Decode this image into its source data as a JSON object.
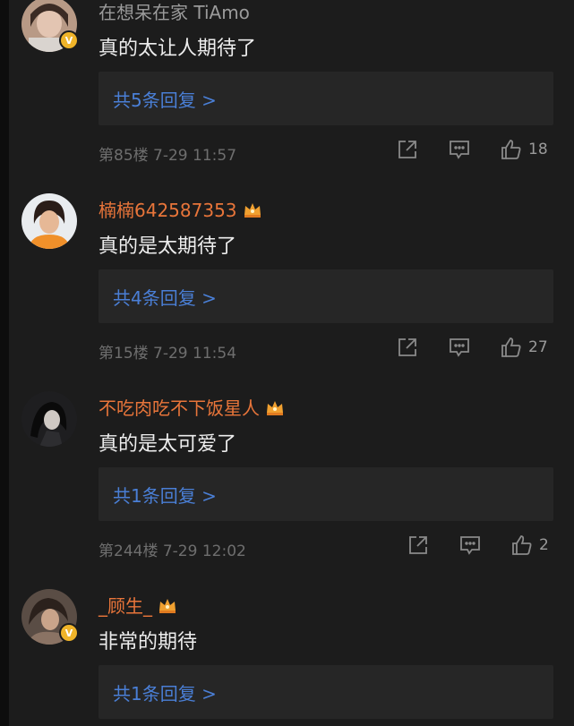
{
  "comments": [
    {
      "username": "在想呆在家 TiAmo",
      "text": "真的太让人期待了",
      "replies_label": "共5条回复 >",
      "meta": "第85楼 7-29 11:57",
      "likes": "18",
      "verified": true,
      "crown": false
    },
    {
      "username": "楠楠642587353",
      "text": "真的是太期待了",
      "replies_label": "共4条回复 >",
      "meta": "第15楼 7-29 11:54",
      "likes": "27",
      "verified": false,
      "crown": true
    },
    {
      "username": "不吃肉吃不下饭星人",
      "text": "真的是太可爱了",
      "replies_label": "共1条回复 >",
      "meta": "第244楼 7-29 12:02",
      "likes": "2",
      "verified": false,
      "crown": true
    },
    {
      "username": "_顾生_",
      "text": "非常的期待",
      "replies_label": "共1条回复 >",
      "verified": true,
      "crown": true
    }
  ],
  "colors": {
    "background": "#1c1c1c",
    "username": "#e8753a",
    "link": "#4a7fd6",
    "reply_box": "#262626",
    "verified_badge": "#f0b429",
    "crown": "#f0a030"
  },
  "icons": [
    "share-icon",
    "comment-icon",
    "like-icon",
    "crown-icon",
    "verified-badge-icon"
  ]
}
